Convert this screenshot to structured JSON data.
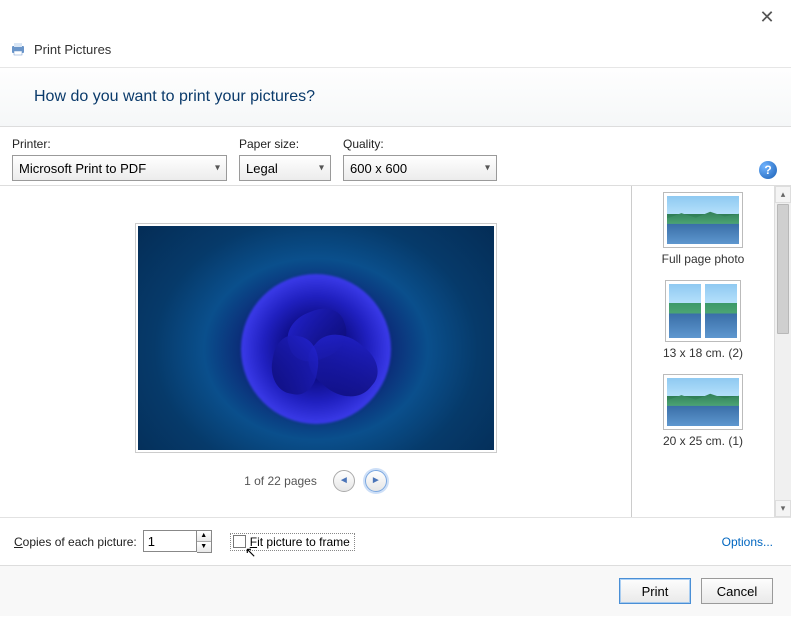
{
  "window": {
    "title": "Print Pictures"
  },
  "question": "How do you want to print your pictures?",
  "labels": {
    "printer": "Printer:",
    "paper": "Paper size:",
    "quality": "Quality:",
    "copies": "Copies of each picture:",
    "fit": "Fit picture to frame",
    "options": "Options..."
  },
  "values": {
    "printer": "Microsoft Print to PDF",
    "paper": "Legal",
    "quality": "600 x 600",
    "copies": "1"
  },
  "pager": {
    "text": "1 of 22 pages"
  },
  "layouts": [
    {
      "label": "Full page photo"
    },
    {
      "label": "13 x 18 cm. (2)"
    },
    {
      "label": "20 x 25 cm. (1)"
    }
  ],
  "buttons": {
    "print": "Print",
    "cancel": "Cancel"
  }
}
